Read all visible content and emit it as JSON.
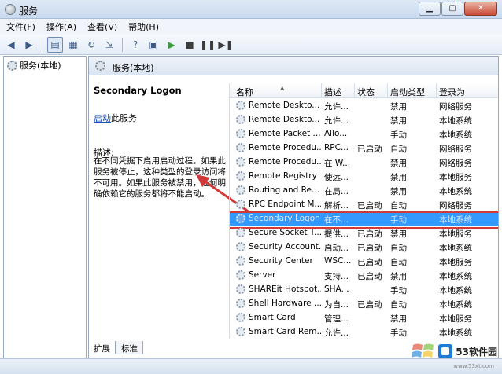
{
  "window": {
    "title": "服务"
  },
  "menu": [
    "文件(F)",
    "操作(A)",
    "查看(V)",
    "帮助(H)"
  ],
  "left": {
    "tree_root": "服务(本地)"
  },
  "right": {
    "header_title": "服务(本地)",
    "selected_service": "Secondary Logon",
    "action_link": "启动",
    "action_suffix": "此服务",
    "description_label": "描述:",
    "description_text": "在不同凭据下启用启动过程。如果此服务被停止，这种类型的登录访问将不可用。如果此服务被禁用，任何明确依赖它的服务都将不能启动。"
  },
  "table": {
    "headers": {
      "name": "名称",
      "desc": "描述",
      "status": "状态",
      "startup": "启动类型",
      "logon": "登录为"
    },
    "rows": [
      {
        "name": "Remote Deskto...",
        "desc": "允许...",
        "status": "",
        "startup": "禁用",
        "logon": "网络服务"
      },
      {
        "name": "Remote Deskto...",
        "desc": "允许...",
        "status": "",
        "startup": "禁用",
        "logon": "本地系统"
      },
      {
        "name": "Remote Packet ...",
        "desc": "Allo...",
        "status": "",
        "startup": "手动",
        "logon": "本地系统"
      },
      {
        "name": "Remote Procedu...",
        "desc": "RPC...",
        "status": "已启动",
        "startup": "自动",
        "logon": "网络服务"
      },
      {
        "name": "Remote Procedu...",
        "desc": "在 W...",
        "status": "",
        "startup": "禁用",
        "logon": "网络服务"
      },
      {
        "name": "Remote Registry",
        "desc": "使远...",
        "status": "",
        "startup": "禁用",
        "logon": "本地服务"
      },
      {
        "name": "Routing and Re...",
        "desc": "在局...",
        "status": "",
        "startup": "禁用",
        "logon": "本地系统"
      },
      {
        "name": "RPC Endpoint M...",
        "desc": "解析...",
        "status": "已启动",
        "startup": "自动",
        "logon": "网络服务"
      },
      {
        "name": "Secondary Logon",
        "desc": "在不...",
        "status": "",
        "startup": "手动",
        "logon": "本地系统",
        "selected": true
      },
      {
        "name": "Secure Socket T...",
        "desc": "提供...",
        "status": "已启动",
        "startup": "禁用",
        "logon": "本地服务"
      },
      {
        "name": "Security Account...",
        "desc": "启动...",
        "status": "已启动",
        "startup": "自动",
        "logon": "本地系统"
      },
      {
        "name": "Security Center",
        "desc": "WSC...",
        "status": "已启动",
        "startup": "自动",
        "logon": "本地服务"
      },
      {
        "name": "Server",
        "desc": "支持...",
        "status": "已启动",
        "startup": "禁用",
        "logon": "本地系统"
      },
      {
        "name": "SHAREit Hotspot...",
        "desc": "SHA...",
        "status": "",
        "startup": "手动",
        "logon": "本地系统"
      },
      {
        "name": "Shell Hardware ...",
        "desc": "为自...",
        "status": "已启动",
        "startup": "自动",
        "logon": "本地系统"
      },
      {
        "name": "Smart Card",
        "desc": "管理...",
        "status": "",
        "startup": "禁用",
        "logon": "本地服务"
      },
      {
        "name": "Smart Card Rem...",
        "desc": "允许...",
        "status": "",
        "startup": "手动",
        "logon": "本地系统"
      }
    ]
  },
  "tabs": [
    "扩展",
    "标准"
  ],
  "watermark": {
    "brand": "53软件园",
    "site": "www.53xt.com"
  },
  "colors": {
    "selection": "#3399ff",
    "highlight_box": "#d23a3a",
    "link": "#1a4fb5"
  }
}
